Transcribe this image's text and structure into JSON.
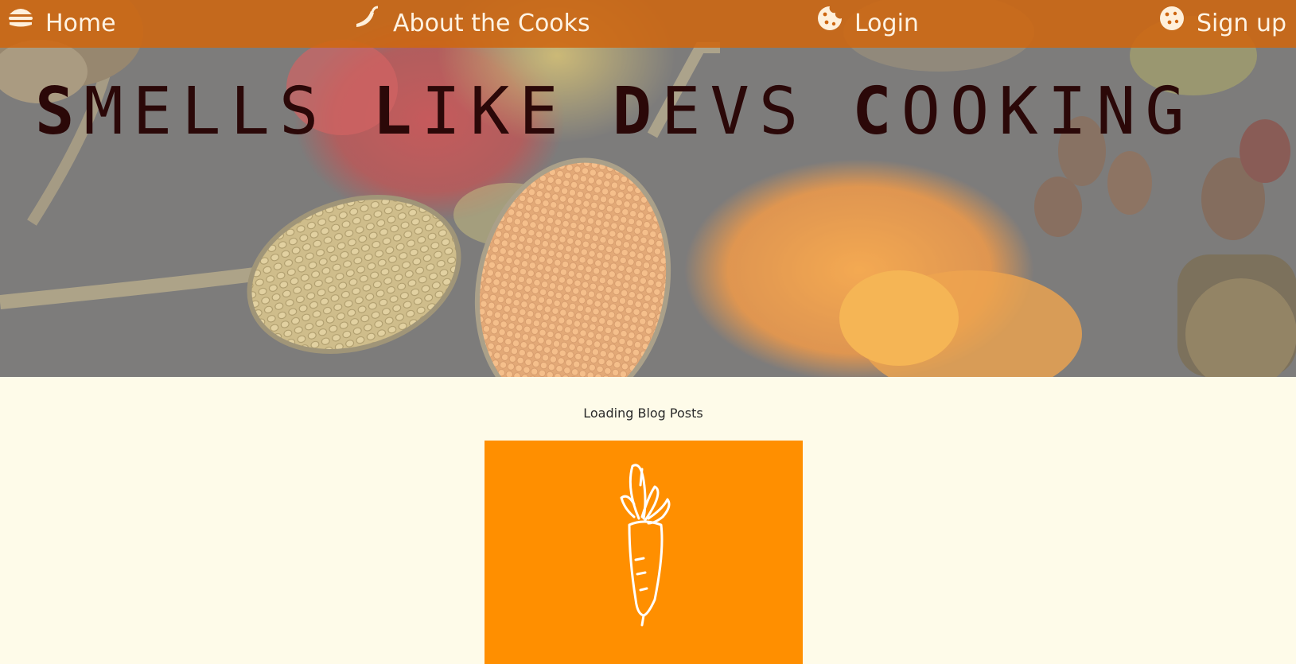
{
  "nav": {
    "items": [
      {
        "label": "Home",
        "icon": "burger-icon"
      },
      {
        "label": "About the Cooks",
        "icon": "chili-pepper-icon"
      },
      {
        "label": "Login",
        "icon": "cookie-icon"
      },
      {
        "label": "Sign up",
        "icon": "cookie-icon"
      }
    ]
  },
  "hero": {
    "title_words": [
      {
        "initial": "S",
        "rest": "MELLS"
      },
      {
        "initial": "L",
        "rest": "IKE"
      },
      {
        "initial": "D",
        "rest": "EVS"
      },
      {
        "initial": "C",
        "rest": "OOKING"
      }
    ],
    "background": "spices-on-spoons-photo"
  },
  "main": {
    "loading_text": "Loading Blog Posts",
    "card": {
      "icon": "carrot-icon",
      "color": "#ff8f00"
    }
  },
  "colors": {
    "nav_bg": "#ce6610",
    "page_bg": "#fefbe9",
    "title": "#2b0808",
    "card": "#ff8f00"
  }
}
